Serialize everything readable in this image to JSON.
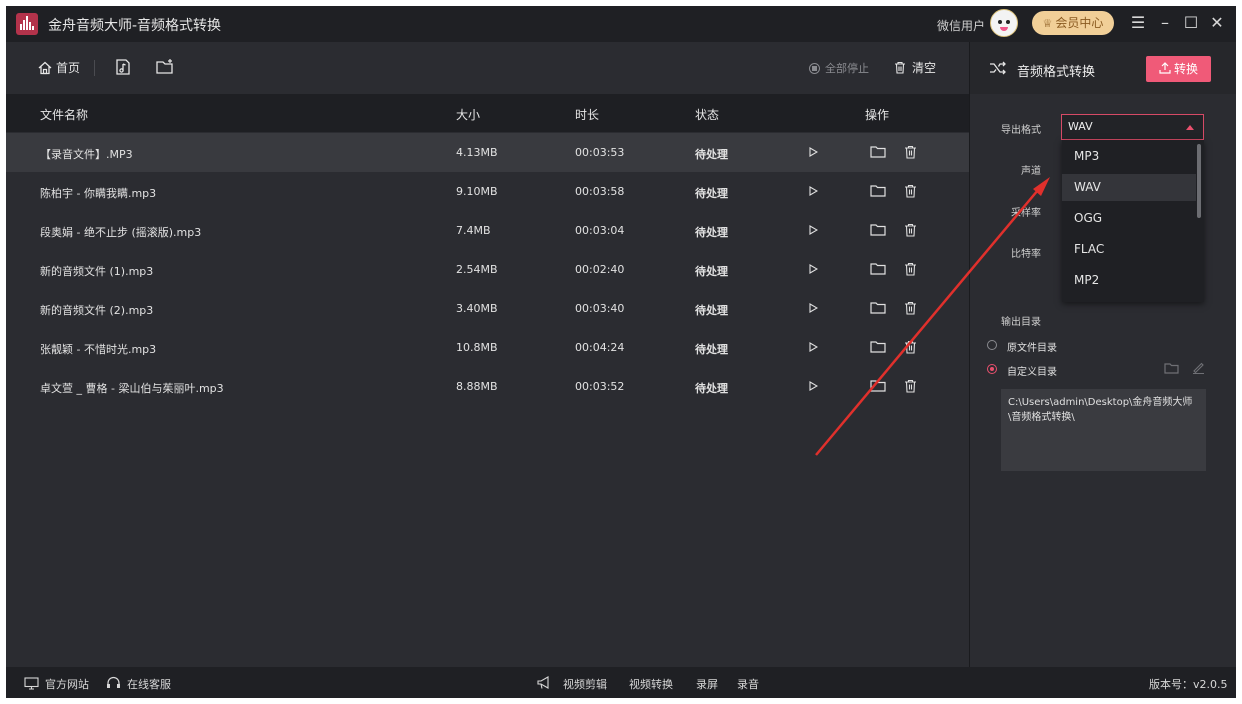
{
  "window": {
    "title": "金舟音频大师-音频格式转换"
  },
  "header": {
    "user_name": "微信用户",
    "vip_label": "会员中心"
  },
  "toolbar": {
    "home_label": "首页",
    "stop_all_label": "全部停止",
    "clear_label": "清空"
  },
  "table": {
    "columns": [
      "文件名称",
      "大小",
      "时长",
      "状态",
      "操作"
    ],
    "rows": [
      {
        "name": "【录音文件】.MP3",
        "size": "4.13MB",
        "duration": "00:03:53",
        "status": "待处理"
      },
      {
        "name": "陈柏宇 - 你瞒我瞒.mp3",
        "size": "9.10MB",
        "duration": "00:03:58",
        "status": "待处理"
      },
      {
        "name": "段奥娟 - 绝不止步 (摇滚版).mp3",
        "size": "7.4MB",
        "duration": "00:03:04",
        "status": "待处理"
      },
      {
        "name": "新的音频文件 (1).mp3",
        "size": "2.54MB",
        "duration": "00:02:40",
        "status": "待处理"
      },
      {
        "name": "新的音频文件 (2).mp3",
        "size": "3.40MB",
        "duration": "00:03:40",
        "status": "待处理"
      },
      {
        "name": "张靓颖 - 不惜时光.mp3",
        "size": "10.8MB",
        "duration": "00:04:24",
        "status": "待处理"
      },
      {
        "name": "卓文萱 _ 曹格 - 梁山伯与茱丽叶.mp3",
        "size": "8.88MB",
        "duration": "00:03:52",
        "status": "待处理"
      }
    ]
  },
  "panel": {
    "title": "音频格式转换",
    "convert_label": "转换",
    "export_format_label": "导出格式",
    "export_format_value": "WAV",
    "channel_label": "声道",
    "sample_rate_label": "采样率",
    "bitrate_label": "比特率",
    "format_options": [
      "MP3",
      "WAV",
      "OGG",
      "FLAC",
      "MP2"
    ],
    "selected_format": "WAV",
    "output_dir_label": "输出目录",
    "source_dir_label": "原文件目录",
    "custom_dir_label": "自定义目录",
    "output_path": "C:\\Users\\admin\\Desktop\\金舟音频大师\\音频格式转换\\"
  },
  "footer": {
    "website_label": "官方网站",
    "support_label": "在线客服",
    "video_edit_label": "视频剪辑",
    "video_convert_label": "视频转换",
    "record_screen_label": "录屏",
    "record_audio_label": "录音",
    "version_label": "版本号：v2.0.5"
  },
  "colors": {
    "accent": "#f05a78",
    "annotation_arrow": "#e0302c",
    "vip": "#f1cf98"
  }
}
